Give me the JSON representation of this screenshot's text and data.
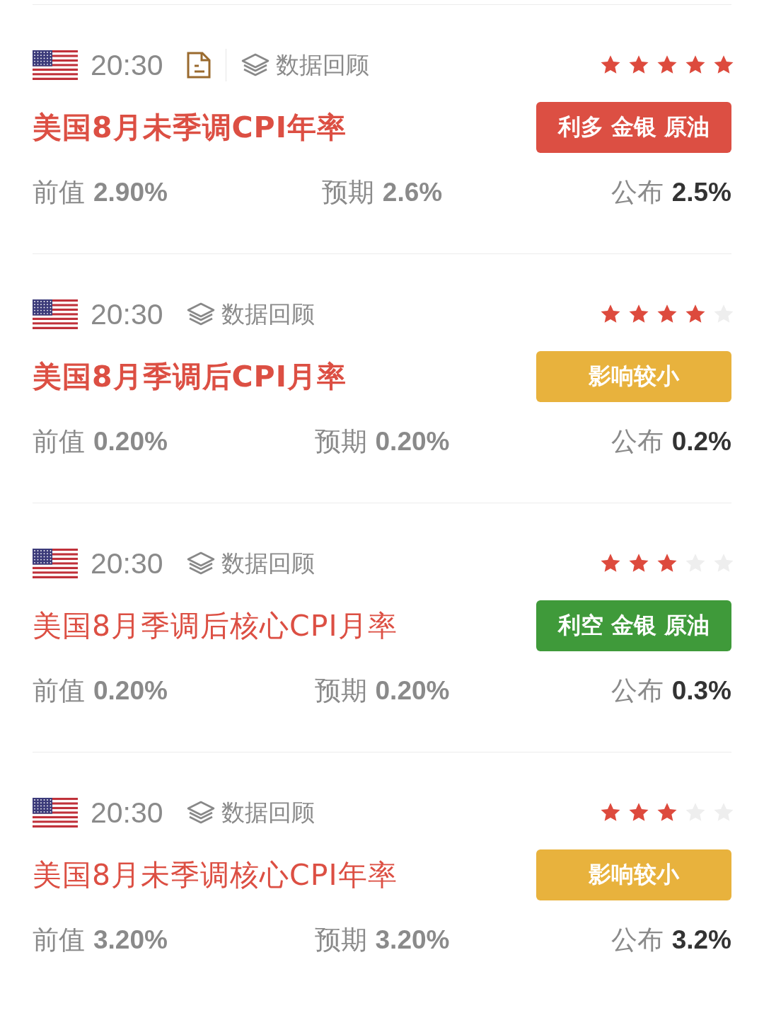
{
  "events": [
    {
      "time": "20:30",
      "has_report": true,
      "review": "数据回顾",
      "stars": 5,
      "title": "美国8月未季调CPI年率",
      "title_bold": true,
      "tag": {
        "kind": "bullish",
        "text": "利多 金银 原油"
      },
      "previous": {
        "label": "前值",
        "value": "2.90%"
      },
      "forecast": {
        "label": "预期",
        "value": "2.6%"
      },
      "actual": {
        "label": "公布",
        "value": "2.5%"
      }
    },
    {
      "time": "20:30",
      "has_report": false,
      "review": "数据回顾",
      "stars": 4,
      "title": "美国8月季调后CPI月率",
      "title_bold": true,
      "tag": {
        "kind": "minor",
        "text": "影响较小"
      },
      "previous": {
        "label": "前值",
        "value": "0.20%"
      },
      "forecast": {
        "label": "预期",
        "value": "0.20%"
      },
      "actual": {
        "label": "公布",
        "value": "0.2%"
      }
    },
    {
      "time": "20:30",
      "has_report": false,
      "review": "数据回顾",
      "stars": 3,
      "title": "美国8月季调后核心CPI月率",
      "title_bold": false,
      "tag": {
        "kind": "bearish",
        "text": "利空 金银 原油"
      },
      "previous": {
        "label": "前值",
        "value": "0.20%"
      },
      "forecast": {
        "label": "预期",
        "value": "0.20%"
      },
      "actual": {
        "label": "公布",
        "value": "0.3%"
      }
    },
    {
      "time": "20:30",
      "has_report": false,
      "review": "数据回顾",
      "stars": 3,
      "title": "美国8月未季调核心CPI年率",
      "title_bold": false,
      "tag": {
        "kind": "minor",
        "text": "影响较小"
      },
      "previous": {
        "label": "前值",
        "value": "3.20%"
      },
      "forecast": {
        "label": "预期",
        "value": "3.20%"
      },
      "actual": {
        "label": "公布",
        "value": "3.2%"
      }
    }
  ]
}
